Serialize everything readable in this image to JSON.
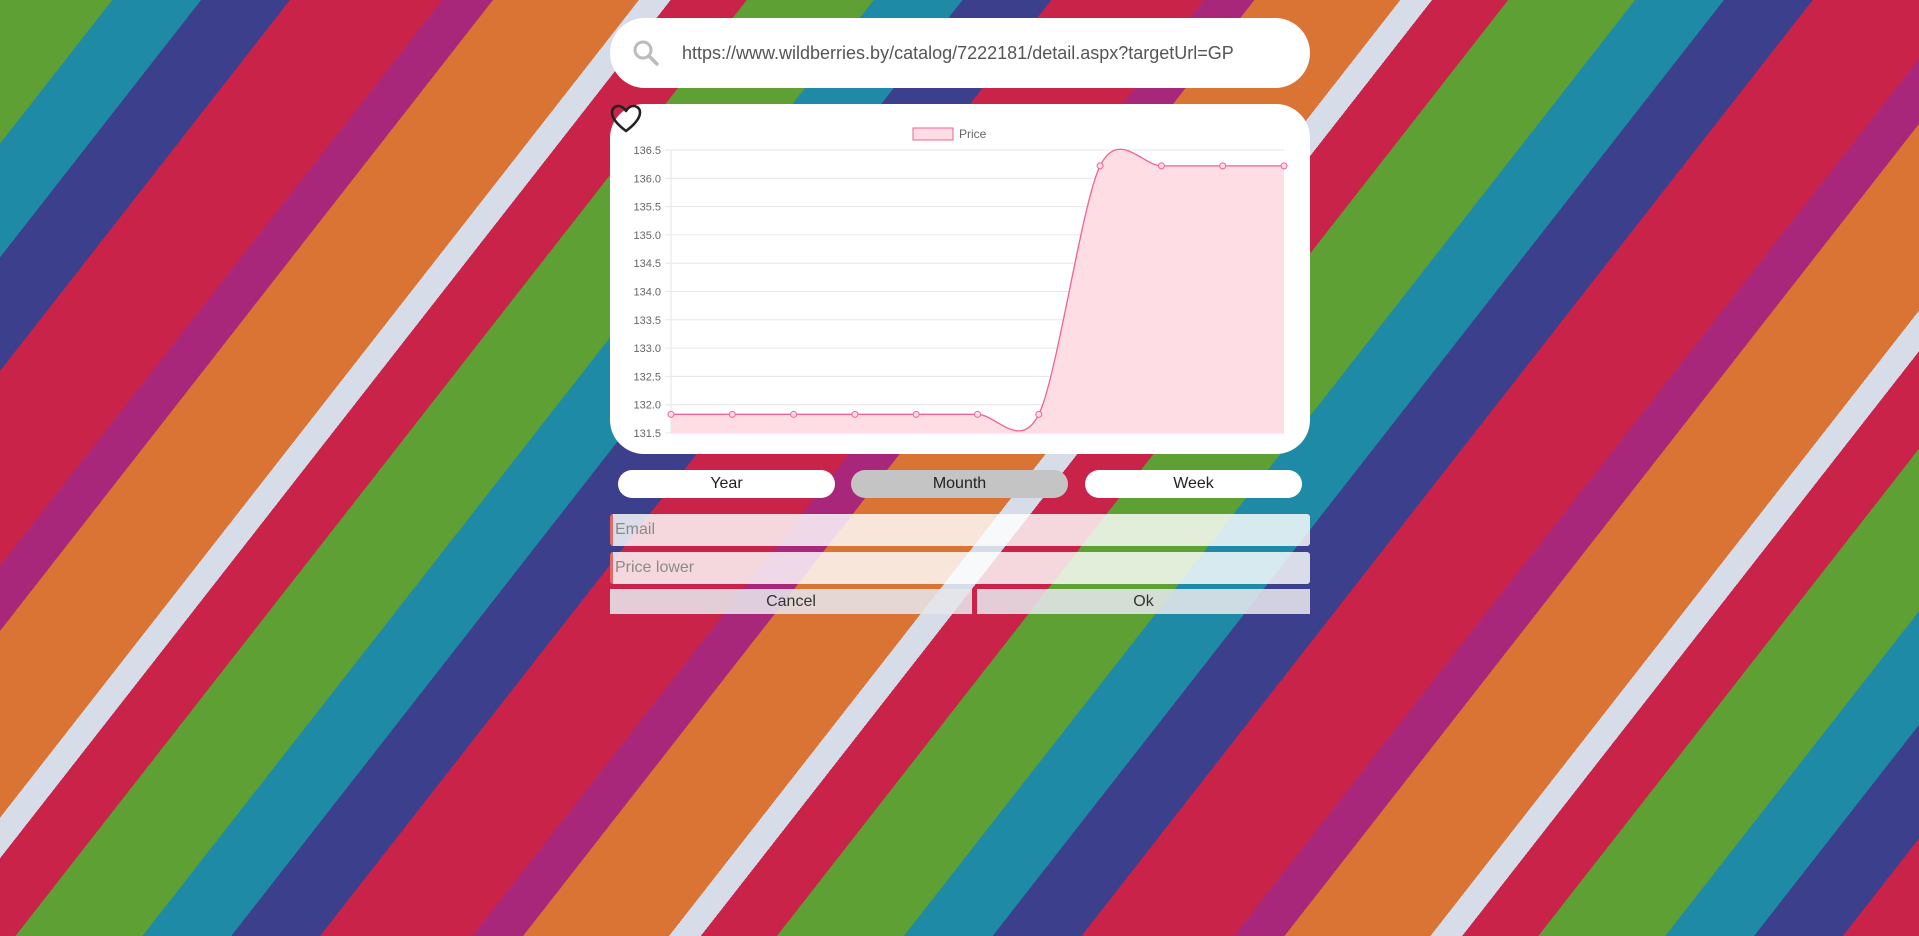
{
  "search": {
    "url": "https://www.wildberries.by/catalog/7222181/detail.aspx?targetUrl=GP"
  },
  "chart_data": {
    "type": "line",
    "area": true,
    "title": "",
    "legend": {
      "position": "top",
      "label": "Price"
    },
    "series": [
      {
        "name": "Price",
        "values": [
          131.83,
          131.83,
          131.83,
          131.83,
          131.83,
          131.83,
          131.83,
          136.22,
          136.22,
          136.22,
          136.22
        ]
      }
    ],
    "ylim": [
      131.5,
      136.5
    ],
    "yticks": [
      "136.5",
      "136.0",
      "135.5",
      "135.0",
      "134.5",
      "134.0",
      "133.5",
      "133.0",
      "132.5",
      "132.0",
      "131.5"
    ],
    "grid": true,
    "colors": {
      "line": "#f06292",
      "fill": "#ffdde4",
      "grid": "#e6e6e6"
    }
  },
  "periods": [
    "Year",
    "Mounth",
    "Week"
  ],
  "active_period": "Mounth",
  "form": {
    "email_placeholder": "Email",
    "price_placeholder": "Price lower",
    "cancel_label": "Cancel",
    "ok_label": "Ok"
  }
}
